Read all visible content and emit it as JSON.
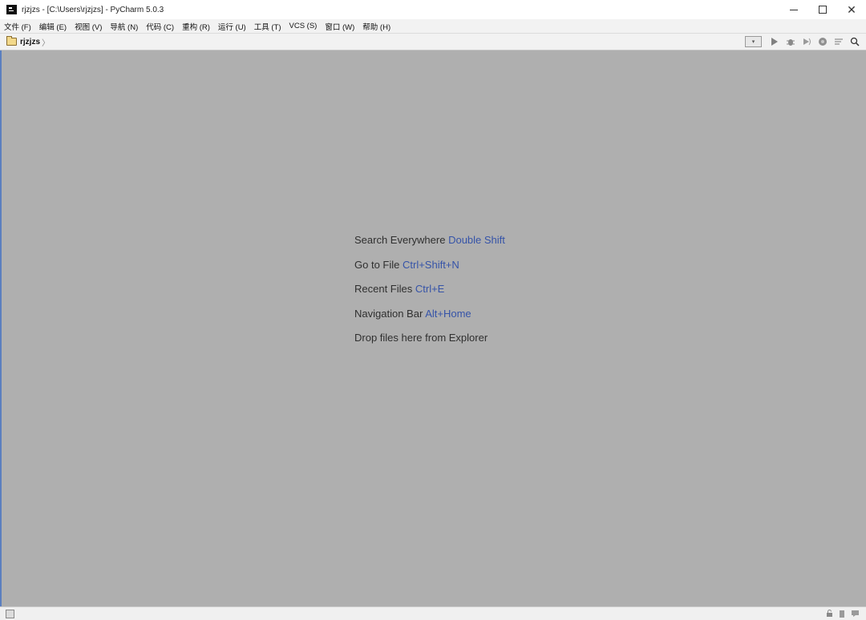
{
  "window": {
    "title": "rjzjzs - [C:\\Users\\rjzjzs] - PyCharm 5.0.3",
    "minimize": "minimize",
    "maximize": "maximize",
    "close": "✕"
  },
  "menu": {
    "items": [
      {
        "label": "文件 (F)"
      },
      {
        "label": "编辑 (E)"
      },
      {
        "label": "视图 (V)"
      },
      {
        "label": "导航 (N)"
      },
      {
        "label": "代码 (C)"
      },
      {
        "label": "重构 (R)"
      },
      {
        "label": "运行 (U)"
      },
      {
        "label": "工具 (T)"
      },
      {
        "label": "VCS (S)"
      },
      {
        "label": "窗口 (W)"
      },
      {
        "label": "帮助 (H)"
      }
    ]
  },
  "navbar": {
    "project": "rjzjzs",
    "separator": "〉",
    "run_config_arrow": "▾",
    "icons": [
      "play-icon",
      "debug-icon",
      "coverage-icon",
      "profile-icon",
      "structure-icon",
      "search-icon"
    ]
  },
  "hints": [
    {
      "label": "Search Everywhere",
      "shortcut": "Double Shift"
    },
    {
      "label": "Go to File",
      "shortcut": "Ctrl+Shift+N"
    },
    {
      "label": "Recent Files",
      "shortcut": "Ctrl+E"
    },
    {
      "label": "Navigation Bar",
      "shortcut": "Alt+Home"
    },
    {
      "label": "Drop files here from Explorer",
      "shortcut": ""
    }
  ],
  "colors": {
    "background": "#afafaf",
    "shortcut": "#3553a8",
    "accent_strip": "#5b7fbf"
  }
}
